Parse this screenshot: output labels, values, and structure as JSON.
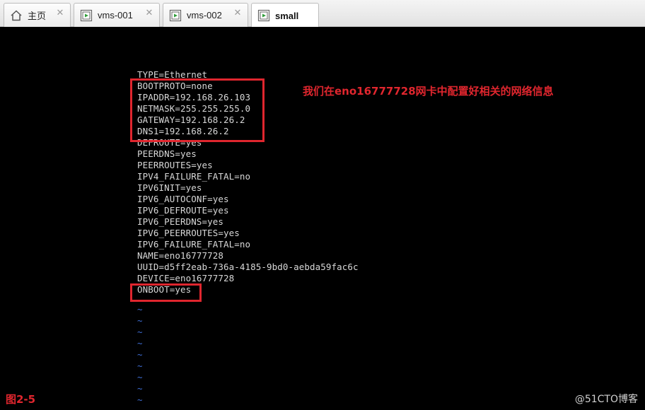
{
  "tabs": [
    {
      "label": "主页",
      "icon": "home-icon",
      "active": false
    },
    {
      "label": "vms-001",
      "icon": "vm-icon",
      "active": false
    },
    {
      "label": "vms-002",
      "icon": "vm-icon",
      "active": false
    },
    {
      "label": "small",
      "icon": "vm-icon",
      "active": true
    }
  ],
  "colors": {
    "annotation": "#e0262e",
    "tilde": "#3f6fd8",
    "text": "#d8d8d8"
  },
  "terminal": {
    "lines": [
      "TYPE=Ethernet",
      "BOOTPROTO=none",
      "IPADDR=192.168.26.103",
      "NETMASK=255.255.255.0",
      "GATEWAY=192.168.26.2",
      "DNS1=192.168.26.2",
      "DEFROUTE=yes",
      "PEERDNS=yes",
      "PEERROUTES=yes",
      "IPV4_FAILURE_FATAL=no",
      "IPV6INIT=yes",
      "IPV6_AUTOCONF=yes",
      "IPV6_DEFROUTE=yes",
      "IPV6_PEERDNS=yes",
      "IPV6_PEERROUTES=yes",
      "IPV6_FAILURE_FATAL=no",
      "NAME=eno16777728",
      "UUID=d5ff2eab-736a-4185-9bd0-aebda59fac6c",
      "DEVICE=eno16777728",
      "ONBOOT=yes"
    ],
    "tilde": "~",
    "tilde_count": 9
  },
  "annotation": "我们在eno16777728网卡中配置好相关的网络信息",
  "figure_label": "图2-5",
  "watermark": "@51CTO博客"
}
